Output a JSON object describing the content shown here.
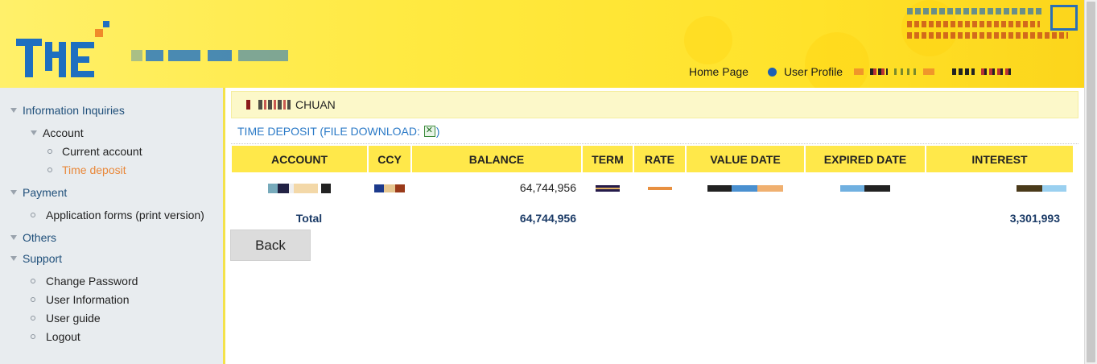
{
  "header": {
    "nav": {
      "home": "Home Page",
      "profile": "User Profile"
    }
  },
  "sidebar": {
    "information_inquiries": "Information Inquiries",
    "account": "Account",
    "current_account": "Current account",
    "time_deposit": "Time deposit",
    "payment": "Payment",
    "application_forms": "Application forms (print version)",
    "others": "Others",
    "support": "Support",
    "change_password": "Change Password",
    "user_information": "User Information",
    "user_guide": "User guide",
    "logout": "Logout"
  },
  "main": {
    "user_name": "CHUAN",
    "title_prefix": "TIME DEPOSIT (FILE DOWNLOAD: ",
    "title_suffix": ")",
    "table": {
      "headers": [
        "ACCOUNT",
        "CCY",
        "BALANCE",
        "TERM",
        "RATE",
        "VALUE DATE",
        "EXPIRED DATE",
        "INTEREST"
      ],
      "row": {
        "balance": "64,744,956"
      },
      "total": {
        "label": "Total",
        "balance": "64,744,956",
        "interest": "3,301,993"
      }
    },
    "back_label": "Back"
  },
  "colors": {
    "accent_yellow": "#ffe84a",
    "link_blue": "#2b7ac7",
    "active_orange": "#e9883a",
    "sidebar_bg": "#e8ecef"
  }
}
